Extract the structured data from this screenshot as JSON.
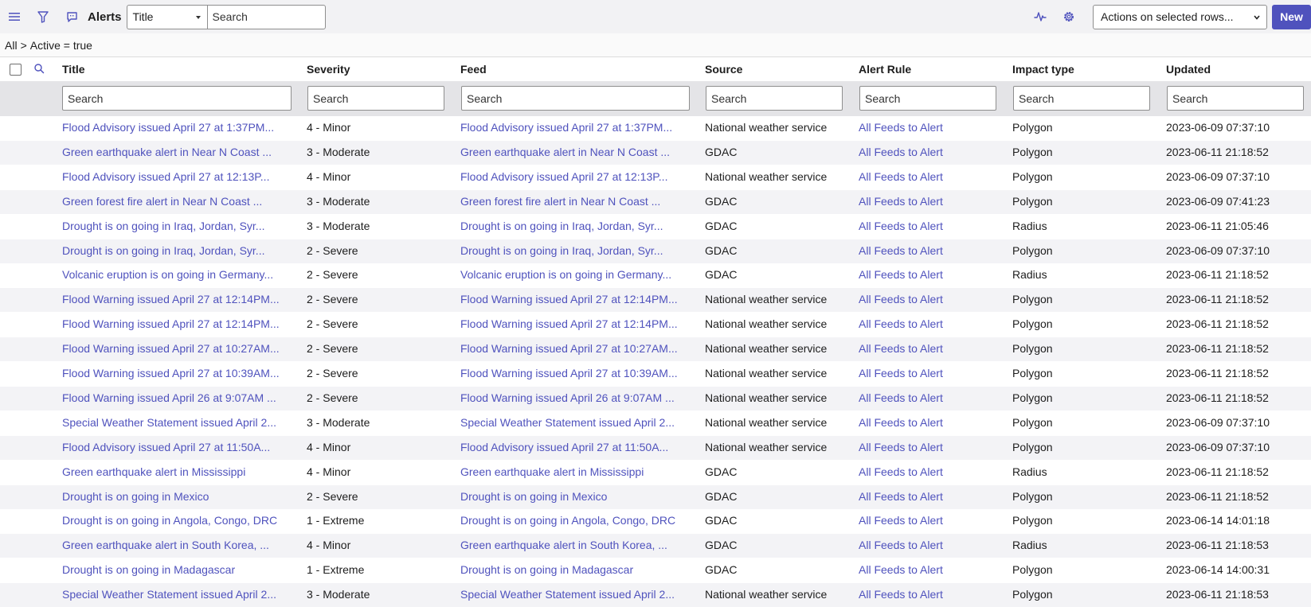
{
  "header": {
    "title": "Alerts",
    "field_select": "Title",
    "search_placeholder": "Search",
    "actions_select": "Actions on selected rows...",
    "new_label": "New",
    "icons": [
      "menu-icon",
      "filter-icon",
      "comment-icon",
      "activity-icon",
      "gear-icon"
    ]
  },
  "breadcrumb": {
    "root": "All",
    "sep": ">",
    "condition": "Active = true"
  },
  "table": {
    "columns": [
      "Title",
      "Severity",
      "Feed",
      "Source",
      "Alert Rule",
      "Impact type",
      "Updated"
    ],
    "filter_placeholder": "Search",
    "rows": [
      {
        "title": "Flood Advisory issued April 27 at 1:37PM...",
        "severity": "4 - Minor",
        "feed": "Flood Advisory issued April 27 at 1:37PM...",
        "source": "National weather service",
        "rule": "All Feeds to Alert",
        "impact": "Polygon",
        "updated": "2023-06-09 07:37:10"
      },
      {
        "title": "Green earthquake alert in Near N Coast ...",
        "severity": "3 - Moderate",
        "feed": "Green earthquake alert in Near N Coast ...",
        "source": "GDAC",
        "rule": "All Feeds to Alert",
        "impact": "Polygon",
        "updated": "2023-06-11 21:18:52"
      },
      {
        "title": "Flood Advisory issued April 27 at 12:13P...",
        "severity": "4 - Minor",
        "feed": "Flood Advisory issued April 27 at 12:13P...",
        "source": "National weather service",
        "rule": "All Feeds to Alert",
        "impact": "Polygon",
        "updated": "2023-06-09 07:37:10"
      },
      {
        "title": "Green forest fire alert in Near N Coast ...",
        "severity": "3 - Moderate",
        "feed": "Green forest fire alert in Near N Coast ...",
        "source": "GDAC",
        "rule": "All Feeds to Alert",
        "impact": "Polygon",
        "updated": "2023-06-09 07:41:23"
      },
      {
        "title": "Drought is on going in Iraq, Jordan, Syr...",
        "severity": "3 - Moderate",
        "feed": "Drought is on going in Iraq, Jordan, Syr...",
        "source": "GDAC",
        "rule": "All Feeds to Alert",
        "impact": "Radius",
        "updated": "2023-06-11 21:05:46"
      },
      {
        "title": "Drought is on going in Iraq, Jordan, Syr...",
        "severity": "2 - Severe",
        "feed": "Drought is on going in Iraq, Jordan, Syr...",
        "source": "GDAC",
        "rule": "All Feeds to Alert",
        "impact": "Polygon",
        "updated": "2023-06-09 07:37:10"
      },
      {
        "title": "Volcanic eruption is on going in Germany...",
        "severity": "2 - Severe",
        "feed": "Volcanic eruption is on going in Germany...",
        "source": "GDAC",
        "rule": "All Feeds to Alert",
        "impact": "Radius",
        "updated": "2023-06-11 21:18:52"
      },
      {
        "title": "Flood Warning issued April 27 at 12:14PM...",
        "severity": "2 - Severe",
        "feed": "Flood Warning issued April 27 at 12:14PM...",
        "source": "National weather service",
        "rule": "All Feeds to Alert",
        "impact": "Polygon",
        "updated": "2023-06-11 21:18:52"
      },
      {
        "title": "Flood Warning issued April 27 at 12:14PM...",
        "severity": "2 - Severe",
        "feed": "Flood Warning issued April 27 at 12:14PM...",
        "source": "National weather service",
        "rule": "All Feeds to Alert",
        "impact": "Polygon",
        "updated": "2023-06-11 21:18:52"
      },
      {
        "title": "Flood Warning issued April 27 at 10:27AM...",
        "severity": "2 - Severe",
        "feed": "Flood Warning issued April 27 at 10:27AM...",
        "source": "National weather service",
        "rule": "All Feeds to Alert",
        "impact": "Polygon",
        "updated": "2023-06-11 21:18:52"
      },
      {
        "title": "Flood Warning issued April 27 at 10:39AM...",
        "severity": "2 - Severe",
        "feed": "Flood Warning issued April 27 at 10:39AM...",
        "source": "National weather service",
        "rule": "All Feeds to Alert",
        "impact": "Polygon",
        "updated": "2023-06-11 21:18:52"
      },
      {
        "title": "Flood Warning issued April 26 at 9:07AM ...",
        "severity": "2 - Severe",
        "feed": "Flood Warning issued April 26 at 9:07AM ...",
        "source": "National weather service",
        "rule": "All Feeds to Alert",
        "impact": "Polygon",
        "updated": "2023-06-11 21:18:52"
      },
      {
        "title": "Special Weather Statement issued April 2...",
        "severity": "3 - Moderate",
        "feed": "Special Weather Statement issued April 2...",
        "source": "National weather service",
        "rule": "All Feeds to Alert",
        "impact": "Polygon",
        "updated": "2023-06-09 07:37:10"
      },
      {
        "title": "Flood Advisory issued April 27 at 11:50A...",
        "severity": "4 - Minor",
        "feed": "Flood Advisory issued April 27 at 11:50A...",
        "source": "National weather service",
        "rule": "All Feeds to Alert",
        "impact": "Polygon",
        "updated": "2023-06-09 07:37:10"
      },
      {
        "title": "Green earthquake alert in Mississippi",
        "severity": "4 - Minor",
        "feed": "Green earthquake alert in Mississippi",
        "source": "GDAC",
        "rule": "All Feeds to Alert",
        "impact": "Radius",
        "updated": "2023-06-11 21:18:52"
      },
      {
        "title": "Drought is on going in Mexico",
        "severity": "2 - Severe",
        "feed": "Drought is on going in Mexico",
        "source": "GDAC",
        "rule": "All Feeds to Alert",
        "impact": "Polygon",
        "updated": "2023-06-11 21:18:52"
      },
      {
        "title": "Drought is on going in Angola, Congo, DRC",
        "severity": "1 - Extreme",
        "feed": "Drought is on going in Angola, Congo, DRC",
        "source": "GDAC",
        "rule": "All Feeds to Alert",
        "impact": "Polygon",
        "updated": "2023-06-14 14:01:18"
      },
      {
        "title": "Green earthquake alert in South Korea, ...",
        "severity": "4 - Minor",
        "feed": "Green earthquake alert in South Korea, ...",
        "source": "GDAC",
        "rule": "All Feeds to Alert",
        "impact": "Radius",
        "updated": "2023-06-11 21:18:53"
      },
      {
        "title": "Drought is on going in Madagascar",
        "severity": "1 - Extreme",
        "feed": "Drought is on going in Madagascar",
        "source": "GDAC",
        "rule": "All Feeds to Alert",
        "impact": "Polygon",
        "updated": "2023-06-14 14:00:31"
      },
      {
        "title": "Special Weather Statement issued April 2...",
        "severity": "3 - Moderate",
        "feed": "Special Weather Statement issued April 2...",
        "source": "National weather service",
        "rule": "All Feeds to Alert",
        "impact": "Polygon",
        "updated": "2023-06-11 21:18:53"
      }
    ]
  },
  "colors": {
    "accent": "#4f52bd",
    "header_bg": "#f2f2f4",
    "filter_bg": "#e4e4e7",
    "row_alt": "#f3f3f6"
  }
}
